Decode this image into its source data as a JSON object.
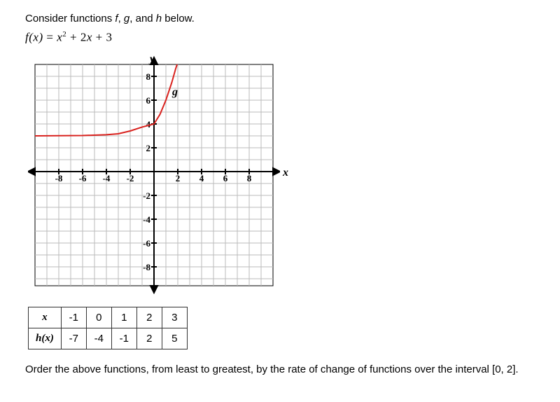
{
  "prompt": {
    "intro": "Consider functions ",
    "f": "f",
    "comma1": ", ",
    "g": "g",
    "comma2": ", and ",
    "h": "h",
    "outro": " below."
  },
  "formula": {
    "lhs_fn": "f",
    "lhs_arg": "(x)",
    "eq": "  =  ",
    "term1_base": "x",
    "term1_exp": "2",
    "plus1": "  +  2",
    "term2_var": "x",
    "plus2": "  +  3"
  },
  "axes": {
    "y_label": "y",
    "x_label": "x",
    "curve_label": "g"
  },
  "table": {
    "row_header_x": "x",
    "row_header_h": "h(x)",
    "x_vals": [
      "-1",
      "0",
      "1",
      "2",
      "3"
    ],
    "h_vals": [
      "-7",
      "-4",
      "-1",
      "2",
      "5"
    ]
  },
  "question": "Order the above functions, from least to greatest, by the rate of change of functions over the interval [0, 2].",
  "chart_data": {
    "type": "line",
    "title": "",
    "xlabel": "x",
    "ylabel": "y",
    "xlim": [
      -9,
      9
    ],
    "ylim": [
      -9,
      9
    ],
    "x_ticks": [
      -8,
      -6,
      -4,
      -2,
      2,
      4,
      6,
      8
    ],
    "y_ticks": [
      -8,
      -6,
      -4,
      -2,
      2,
      4,
      6,
      8
    ],
    "grid": true,
    "series": [
      {
        "name": "g",
        "color": "#d9221e",
        "x": [
          -9,
          -8,
          -7,
          -6,
          -5,
          -4,
          -3,
          -2,
          -1,
          0,
          0.5,
          1,
          1.5,
          2
        ],
        "y": [
          3.0,
          3.01,
          3.02,
          3.04,
          3.07,
          3.12,
          3.22,
          3.41,
          3.74,
          4,
          4.8,
          6,
          7.5,
          9
        ]
      }
    ]
  }
}
